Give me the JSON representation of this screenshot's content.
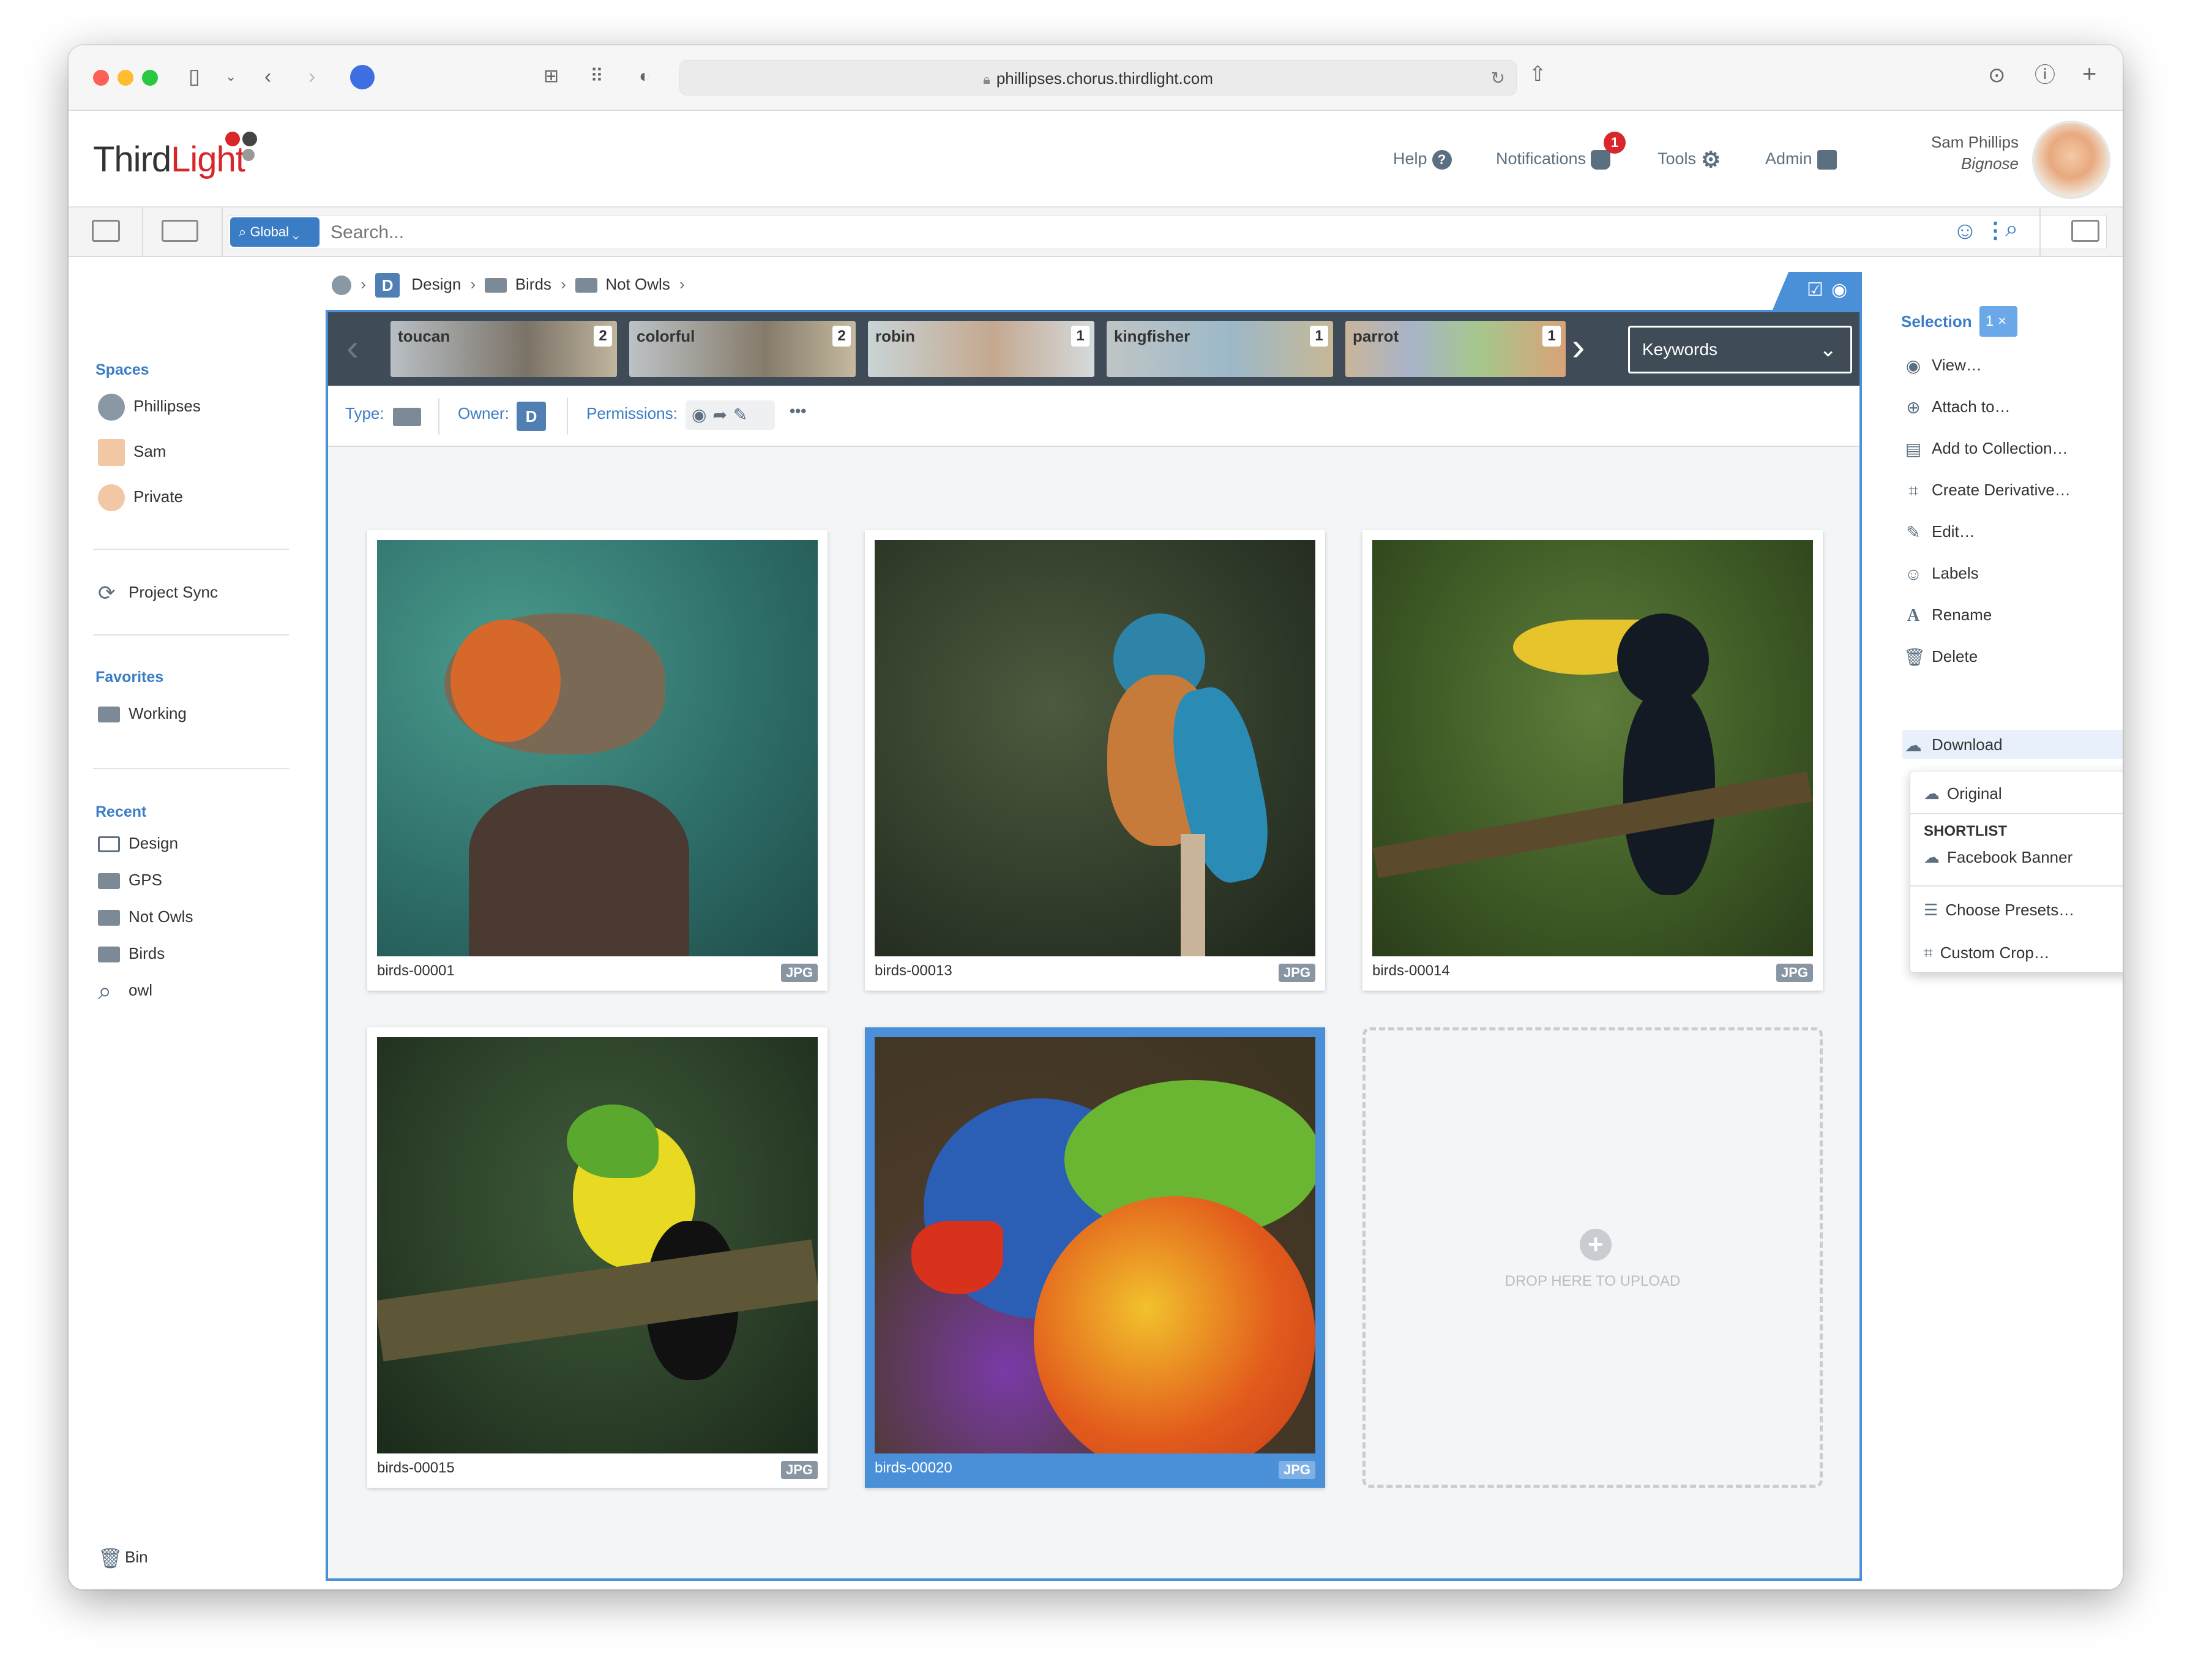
{
  "browser": {
    "url": "phillipses.chorus.thirdlight.com"
  },
  "app": {
    "logo_part1": "Third",
    "logo_part2": "Light",
    "nav": {
      "help": "Help",
      "notifications": "Notifications",
      "notifications_count": "1",
      "tools": "Tools",
      "admin": "Admin"
    },
    "user": {
      "name": "Sam Phillips",
      "org": "Bignose"
    }
  },
  "searchbar": {
    "scope": "Global",
    "placeholder": "Search..."
  },
  "sidebar": {
    "spaces_title": "Spaces",
    "spaces": [
      "Phillipses",
      "Sam",
      "Private"
    ],
    "project_sync": "Project Sync",
    "favorites_title": "Favorites",
    "favorites": [
      "Working"
    ],
    "recent_title": "Recent",
    "recent": [
      "Design",
      "GPS",
      "Not Owls",
      "Birds",
      "owl"
    ],
    "bin": "Bin"
  },
  "breadcrumb": {
    "items": [
      "Design",
      "Birds",
      "Not Owls"
    ],
    "space_initial": "D"
  },
  "tags": [
    {
      "label": "toucan",
      "count": "2"
    },
    {
      "label": "colorful",
      "count": "2"
    },
    {
      "label": "robin",
      "count": "1"
    },
    {
      "label": "kingfisher",
      "count": "1"
    },
    {
      "label": "parrot",
      "count": "1"
    }
  ],
  "keywords_select": "Keywords",
  "filters": {
    "type_label": "Type:",
    "owner_label": "Owner:",
    "owner_initial": "D",
    "permissions_label": "Permissions:",
    "more": "•••"
  },
  "files": [
    {
      "name": "birds-00001",
      "type": "JPG",
      "bird": "robin"
    },
    {
      "name": "birds-00013",
      "type": "JPG",
      "bird": "kingfisher"
    },
    {
      "name": "birds-00014",
      "type": "JPG",
      "bird": "toucan"
    },
    {
      "name": "birds-00015",
      "type": "JPG",
      "bird": "toucan"
    },
    {
      "name": "birds-00020",
      "type": "JPG",
      "bird": "parrot",
      "selected": true
    }
  ],
  "upload_zone": "DROP HERE TO UPLOAD",
  "selection": {
    "title": "Selection",
    "count": "1",
    "actions": [
      "View…",
      "Attach to…",
      "Add to Collection…",
      "Create Derivative…",
      "Edit…",
      "Labels",
      "Rename",
      "Delete",
      "Download"
    ]
  },
  "download_menu": {
    "original": "Original",
    "shortlist_heading": "SHORTLIST",
    "facebook": "Facebook Banner",
    "choose_presets": "Choose Presets…",
    "custom_crop": "Custom Crop…"
  },
  "colors": {
    "accent": "#3b7dc4",
    "selection_blue": "#4a90d9",
    "notification_red": "#d9262b",
    "tagstrip": "#3f4c57"
  }
}
